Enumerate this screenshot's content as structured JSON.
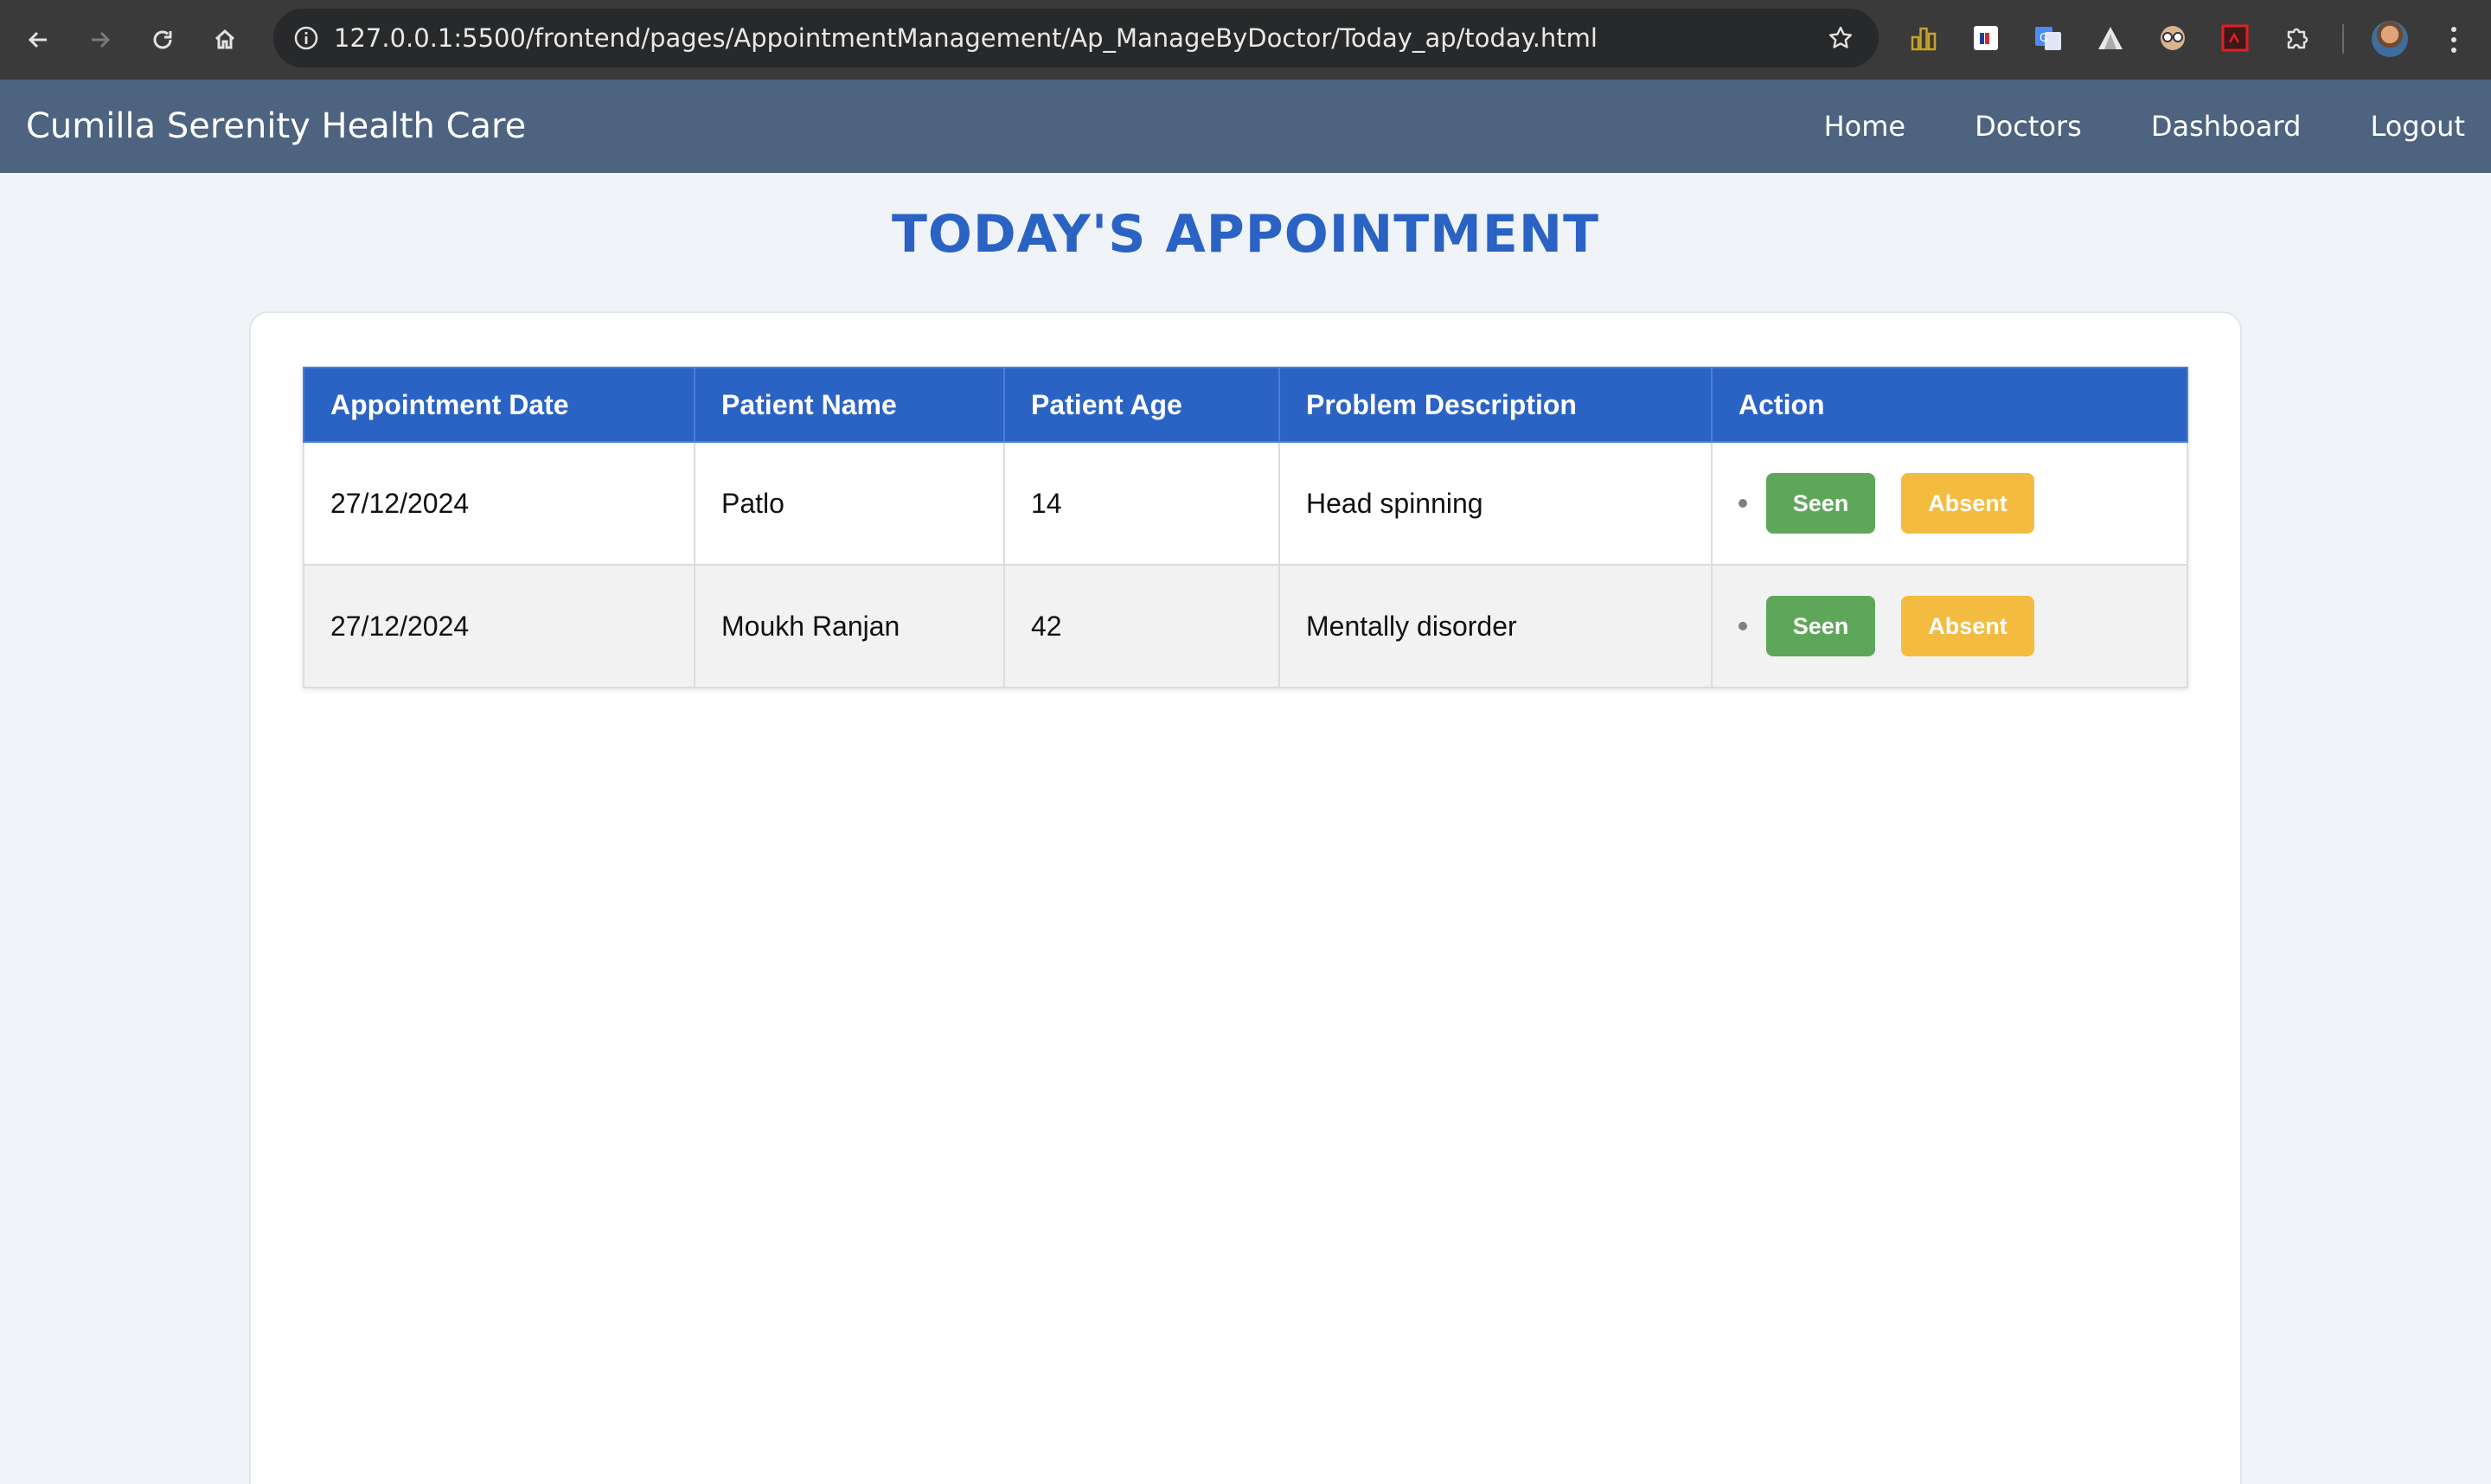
{
  "browser": {
    "url": "127.0.0.1:5500/frontend/pages/AppointmentManagement/Ap_ManageByDoctor/Today_ap/today.html"
  },
  "navbar": {
    "brand": "Cumilla Serenity Health Care",
    "links": [
      "Home",
      "Doctors",
      "Dashboard",
      "Logout"
    ]
  },
  "page": {
    "title": "TODAY'S APPOINTMENT"
  },
  "table": {
    "headers": [
      "Appointment Date",
      "Patient Name",
      "Patient Age",
      "Problem Description",
      "Action"
    ],
    "rows": [
      {
        "date": "27/12/2024",
        "name": "Patlo",
        "age": "14",
        "problem": "Head spinning"
      },
      {
        "date": "27/12/2024",
        "name": "Moukh Ranjan",
        "age": "42",
        "problem": "Mentally disorder"
      }
    ],
    "actions": {
      "seen": "Seen",
      "absent": "Absent"
    }
  },
  "colors": {
    "navbar": "#4d6380",
    "accent": "#2a63c4",
    "seen": "#5ea75a",
    "absent": "#f3bb40"
  }
}
